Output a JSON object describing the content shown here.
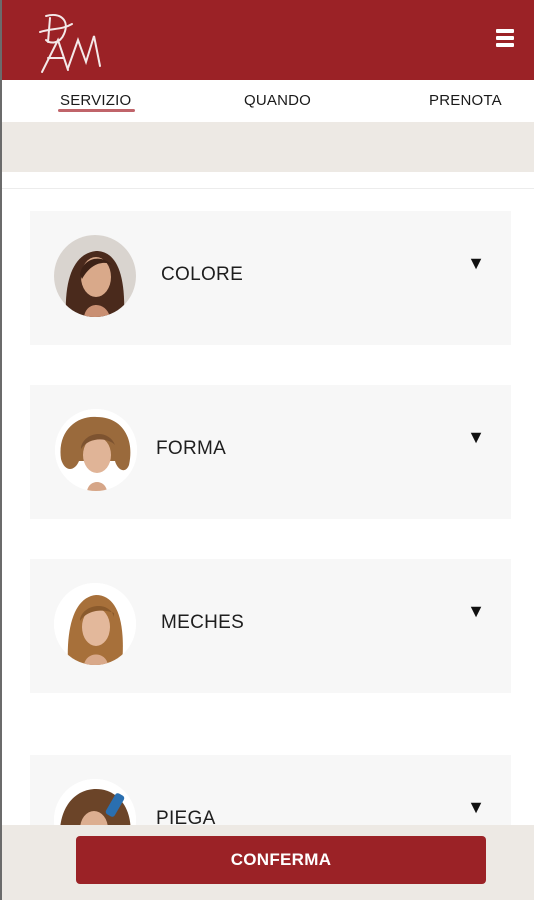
{
  "app": {
    "brand_color": "#9b2226",
    "logo_icon": "dam-monogram-logo"
  },
  "header": {
    "menu_icon": "hamburger-menu-icon"
  },
  "tabs": [
    {
      "label": "SERVIZIO",
      "active": true
    },
    {
      "label": "QUANDO",
      "active": false
    },
    {
      "label": "PRENOTA",
      "active": false
    }
  ],
  "services": [
    {
      "label": "COLORE",
      "icon": "model-photo-colore",
      "expand_icon": "▼"
    },
    {
      "label": "FORMA",
      "icon": "model-photo-forma",
      "expand_icon": "▼"
    },
    {
      "label": "MECHES",
      "icon": "model-photo-meches",
      "expand_icon": "▼"
    },
    {
      "label": "PIEGA",
      "icon": "model-photo-piega",
      "expand_icon": "▼"
    }
  ],
  "footer": {
    "confirm_label": "CONFERMA"
  }
}
